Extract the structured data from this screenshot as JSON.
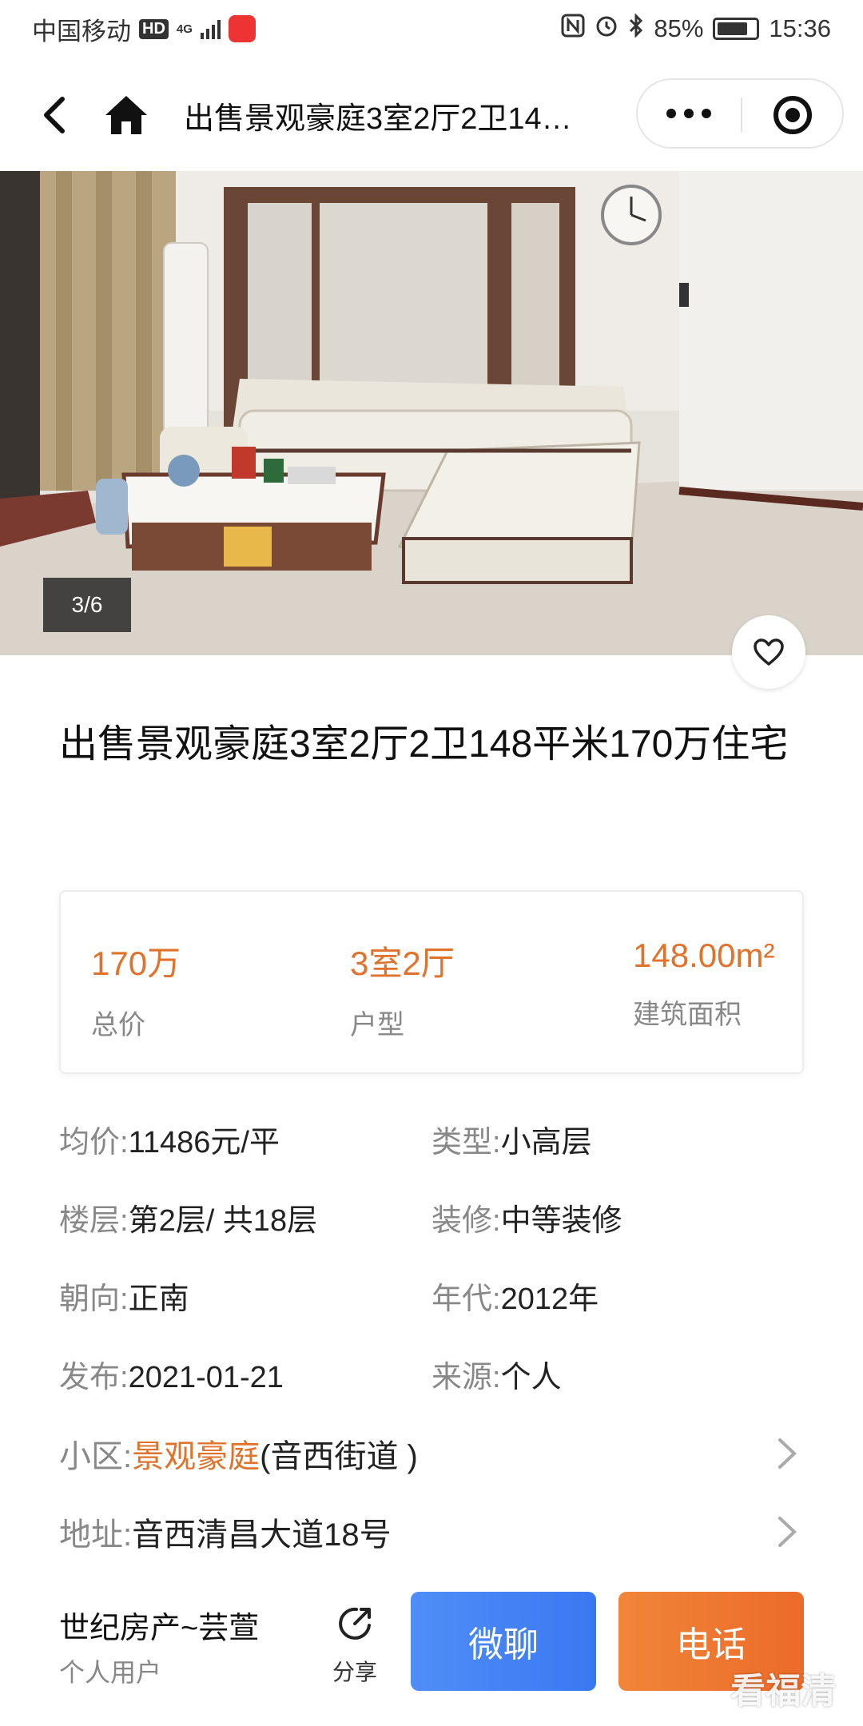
{
  "status_bar": {
    "carrier": "中国移动",
    "hd": "HD",
    "network": "4G",
    "battery": "85%",
    "time": "15:36"
  },
  "nav": {
    "title": "出售景观豪庭3室2厅2卫14…"
  },
  "photo": {
    "counter": "3/6"
  },
  "listing": {
    "title": "出售景观豪庭3室2厅2卫148平米170万住宅"
  },
  "summary": [
    {
      "value": "170万",
      "label": "总价"
    },
    {
      "value": "3室2厅",
      "label": "户型"
    },
    {
      "value": "148.00m²",
      "label": "建筑面积"
    }
  ],
  "details": {
    "unit_price": {
      "key": "均价:",
      "value": "11486元/平"
    },
    "type": {
      "key": "类型:",
      "value": "小高层"
    },
    "floor": {
      "key": "楼层:",
      "value": "第2层/ 共18层"
    },
    "decoration": {
      "key": "装修:",
      "value": "中等装修"
    },
    "orientation": {
      "key": "朝向:",
      "value": "正南"
    },
    "year": {
      "key": "年代:",
      "value": "2012年"
    },
    "published": {
      "key": "发布:",
      "value": "2021-01-21"
    },
    "source": {
      "key": "来源:",
      "value": "个人"
    },
    "community": {
      "key": "小区:",
      "name": "景观豪庭",
      "district": " (音西街道 )"
    },
    "address": {
      "key": "地址:",
      "value": "音西清昌大道18号"
    }
  },
  "bottom": {
    "agent_name": "世纪房产~芸萱",
    "agent_role": "个人用户",
    "share_label": "分享",
    "chat_label": "微聊",
    "call_label": "电话"
  },
  "watermark": "看福清",
  "colors": {
    "accent_orange": "#e0732c",
    "chat_blue": "#4f8ef7",
    "call_orange": "#ec6b2a"
  }
}
